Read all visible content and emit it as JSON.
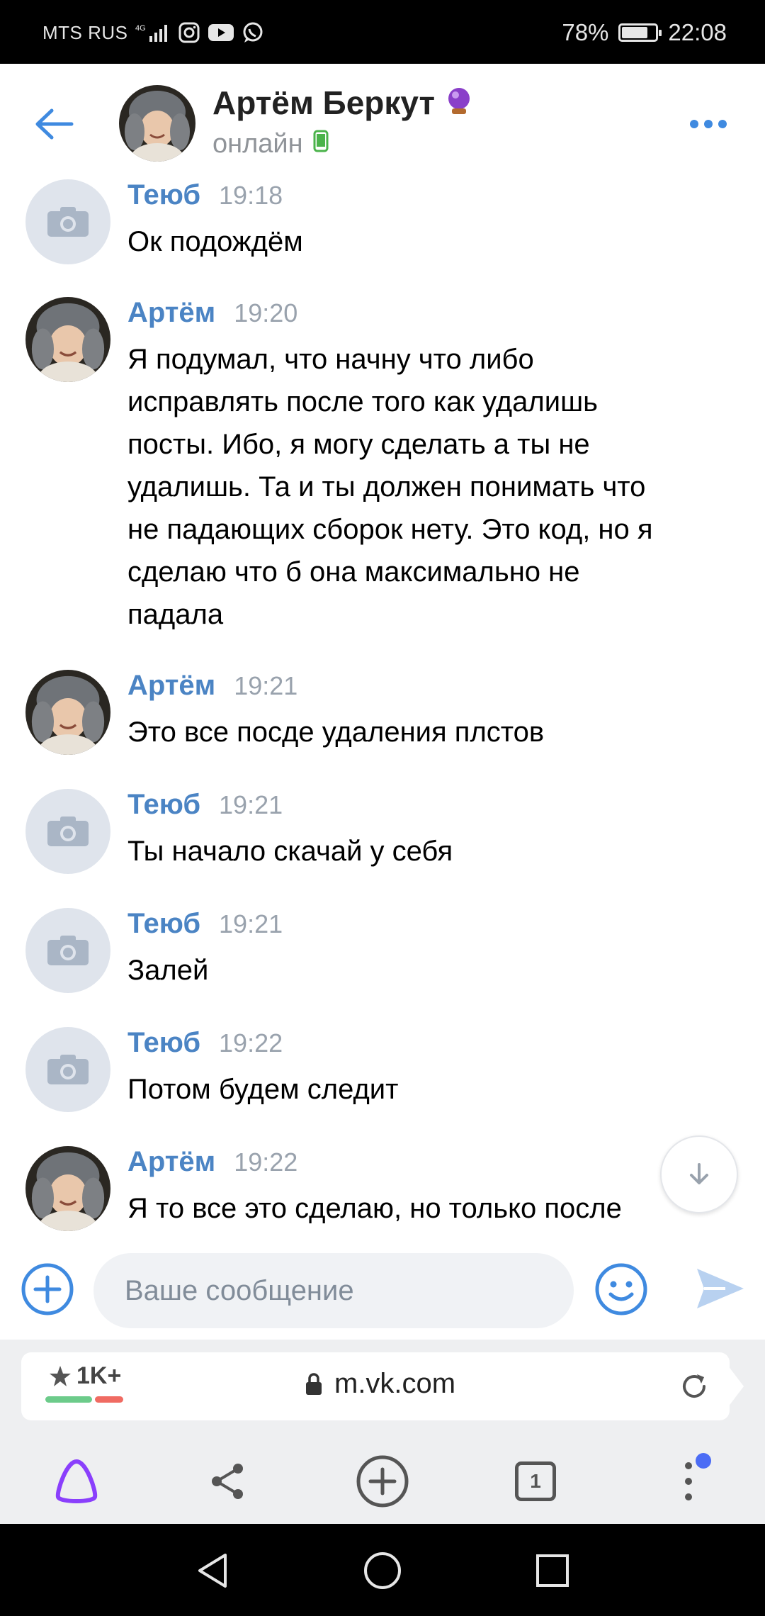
{
  "status_bar": {
    "carrier": "MTS RUS",
    "network": "4G",
    "battery_text": "78%",
    "battery_level": 0.78,
    "time": "22:08",
    "notification_icons": [
      "instagram-icon",
      "youtube-icon",
      "whatsapp-icon"
    ]
  },
  "header": {
    "name": "Артём Беркут",
    "status": "онлайн",
    "badge_icon": "crystal-ball-icon",
    "online_device_icon": "mobile-online-icon"
  },
  "messages": [
    {
      "author": "Теюб",
      "time": "19:18",
      "avatar": "camera-placeholder",
      "lines": [
        "Ок подождём"
      ]
    },
    {
      "author": "Артём",
      "time": "19:20",
      "avatar": "photo",
      "lines": [
        "Я подумал, что начну что либо",
        "исправлять после того как удалишь",
        "посты. Ибо, я могу сделать а ты не",
        "удалишь. Та и ты должен понимать что",
        "не падающих сборок нету. Это код, но я",
        "сделаю что б она максимально не",
        "падала"
      ]
    },
    {
      "author": "Артём",
      "time": "19:21",
      "avatar": "photo",
      "lines": [
        "Это все посде удаления плстов"
      ]
    },
    {
      "author": "Теюб",
      "time": "19:21",
      "avatar": "camera-placeholder",
      "lines": [
        "Ты начало скачай у себя"
      ]
    },
    {
      "author": "Теюб",
      "time": "19:21",
      "avatar": "camera-placeholder",
      "lines": [
        "Залей"
      ]
    },
    {
      "author": "Теюб",
      "time": "19:22",
      "avatar": "camera-placeholder",
      "lines": [
        "Потом будем следит"
      ]
    },
    {
      "author": "Артём",
      "time": "19:22",
      "avatar": "photo",
      "lines": [
        "Я то все это сделаю, но только после"
      ]
    }
  ],
  "composer": {
    "placeholder": "Ваше сообщение"
  },
  "browser": {
    "rating": "1K+",
    "url": "m.vk.com",
    "tabs_count": "1",
    "colors": {
      "rating_green": "#6ccb8a",
      "rating_red": "#f06b62",
      "alice_purple": "#8a3ffc",
      "menu_dot": "#4b6cf5"
    }
  },
  "colors": {
    "accent": "#3f8ae0",
    "author_link": "#4b84c4",
    "time_gray": "#99a2ad"
  }
}
